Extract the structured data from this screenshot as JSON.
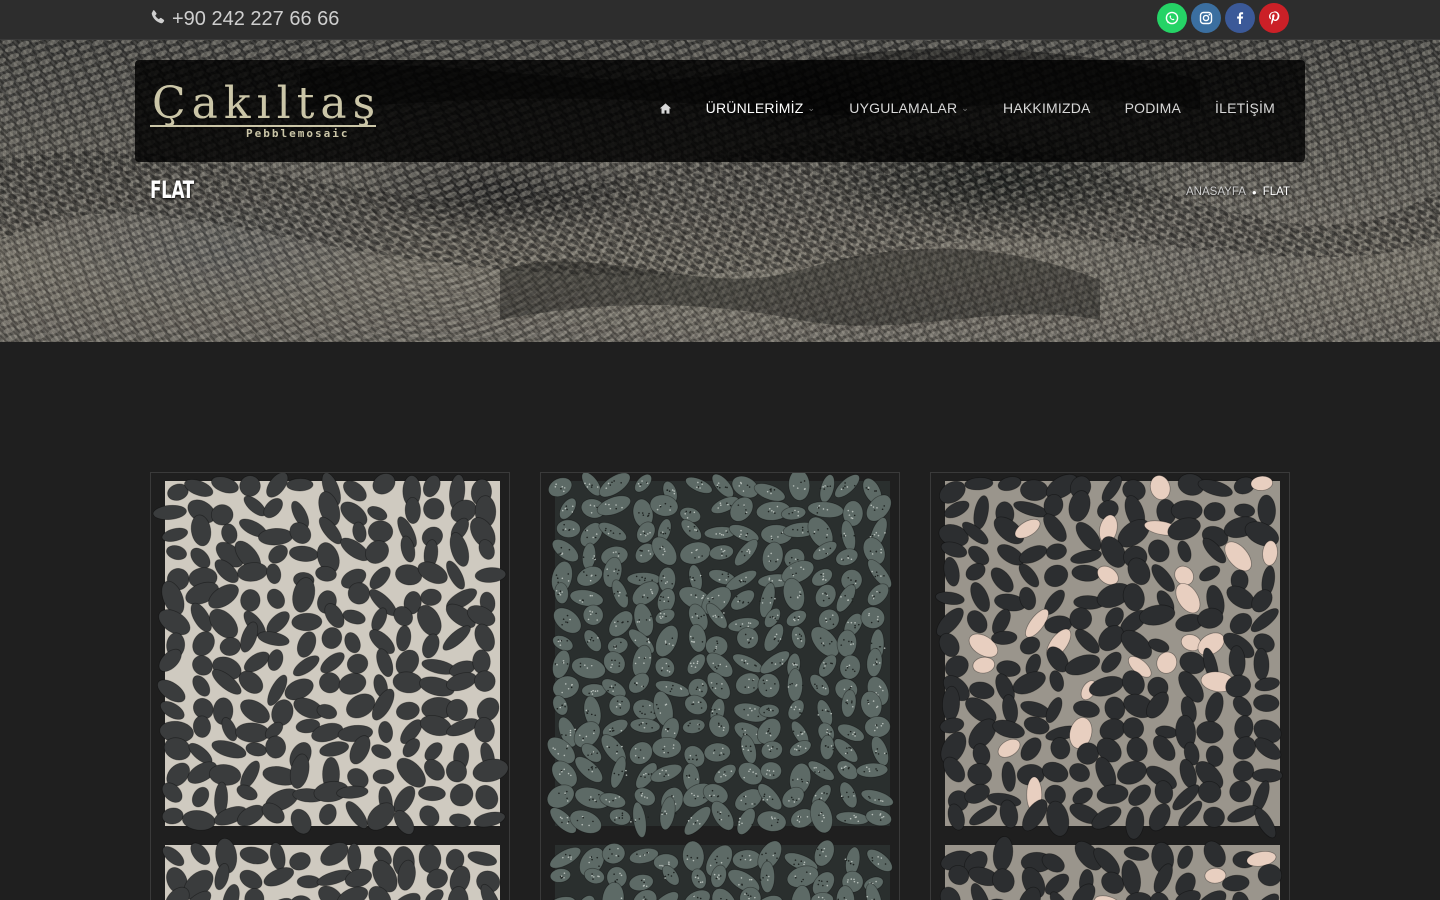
{
  "topbar": {
    "phone": "+90 242 227 66 66",
    "phone_icon": "phone-icon",
    "socials": [
      {
        "name": "whatsapp",
        "icon": "whatsapp-icon",
        "color": "#25d366"
      },
      {
        "name": "instagram",
        "icon": "instagram-icon",
        "color": "#3b6fa0"
      },
      {
        "name": "facebook",
        "icon": "facebook-icon",
        "color": "#3b5998"
      },
      {
        "name": "pinterest",
        "icon": "pinterest-icon",
        "color": "#cb2027"
      }
    ]
  },
  "logo": {
    "name": "Çakıltaş",
    "tagline": "Pebblemosaic"
  },
  "nav": {
    "home_icon": "home-icon",
    "items": [
      {
        "label": "ÜRÜNLERİMİZ",
        "has_dropdown": true
      },
      {
        "label": "UYGULAMALAR",
        "has_dropdown": true
      },
      {
        "label": "HAKKIMIZDA",
        "has_dropdown": false
      },
      {
        "label": "PODIMA",
        "has_dropdown": false
      },
      {
        "label": "İLETİŞİM",
        "has_dropdown": false
      }
    ]
  },
  "page": {
    "title": "FLAT"
  },
  "breadcrumb": {
    "home": "ANASAYFA",
    "current": "FLAT"
  },
  "products": [
    {
      "variant": "black-flat-pebble",
      "colors": {
        "stone": "#3a3c3d",
        "grout": "#cfcac0"
      }
    },
    {
      "variant": "green-granite-flat-pebble",
      "colors": {
        "stone": "#5d6a66",
        "grout": "#2a2f2e"
      }
    },
    {
      "variant": "black-and-white-flat-pebble",
      "colors": {
        "stone": "#2c2e30",
        "accent": "#e8cfc0",
        "grout": "#9a958c"
      }
    }
  ]
}
